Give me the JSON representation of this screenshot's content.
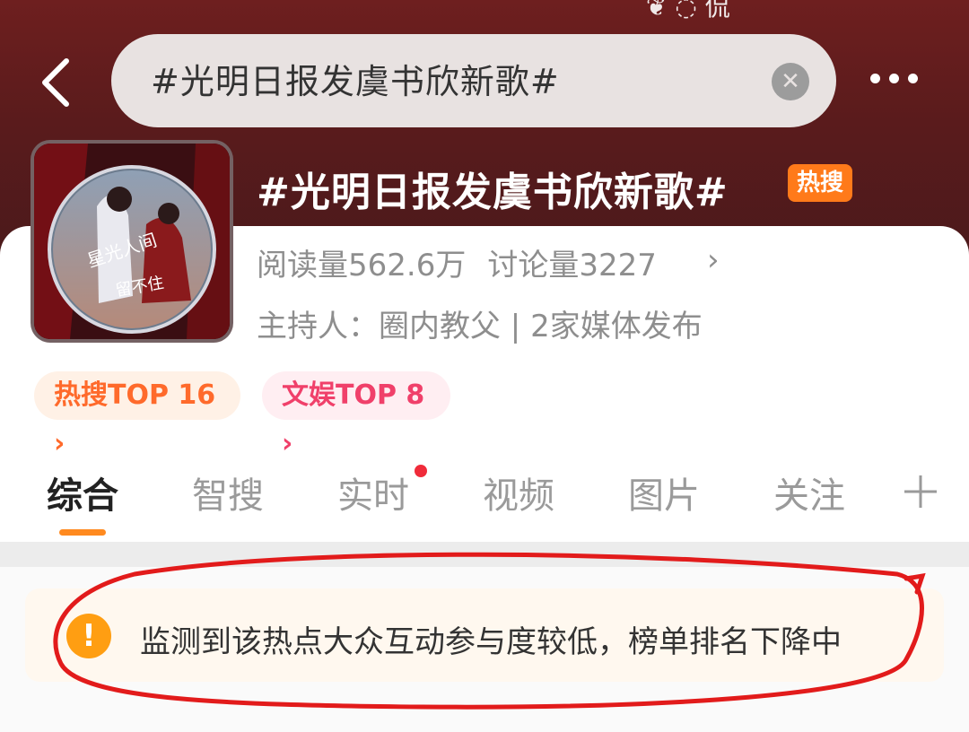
{
  "status_fragment": "❦ ◌ 侃",
  "nav": {
    "back_icon": "chevron-left-icon",
    "search_query": "#光明日报发虞书欣新歌#",
    "clear_icon": "close-icon",
    "more_icon": "more-horizontal-icon"
  },
  "topic": {
    "title": "#光明日报发虞书欣新歌#",
    "badge": "热搜",
    "reads_label": "阅读量562.6万",
    "discussions_label": "讨论量3227",
    "chevron": "›",
    "host_line": "主持人：圈内教父 | 2家媒体发布",
    "cover_art_text": "星光人间\n留不住"
  },
  "rank_pills": [
    {
      "label": "热搜TOP 16 ›"
    },
    {
      "label": "文娱TOP 8 ›"
    }
  ],
  "tabs": [
    {
      "label": "综合",
      "active": true
    },
    {
      "label": "智搜",
      "active": false
    },
    {
      "label": "实时",
      "active": false,
      "dot": true
    },
    {
      "label": "视频",
      "active": false
    },
    {
      "label": "图片",
      "active": false
    },
    {
      "label": "关注",
      "active": false
    }
  ],
  "notice": {
    "icon": "!",
    "text": "监测到该热点大众互动参与度较低，榜单排名下降中"
  },
  "colors": {
    "hero": "#5a1b1c",
    "hot_badge": "#ff7a1a",
    "tab_underline": "#ff8a1f",
    "notice_icon": "#ff9e12",
    "annotation_red": "#e21b1b"
  }
}
